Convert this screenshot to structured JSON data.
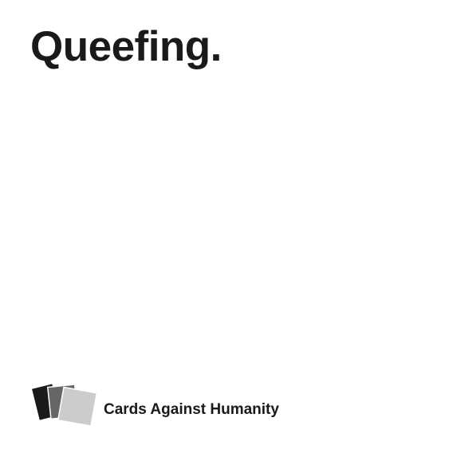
{
  "card": {
    "text": "Queefing.",
    "color": "#ffffff",
    "text_color": "#1a1a1a"
  },
  "footer": {
    "brand_name": "Cards Against Humanity",
    "logo_icon": "stacked-cards-icon"
  }
}
